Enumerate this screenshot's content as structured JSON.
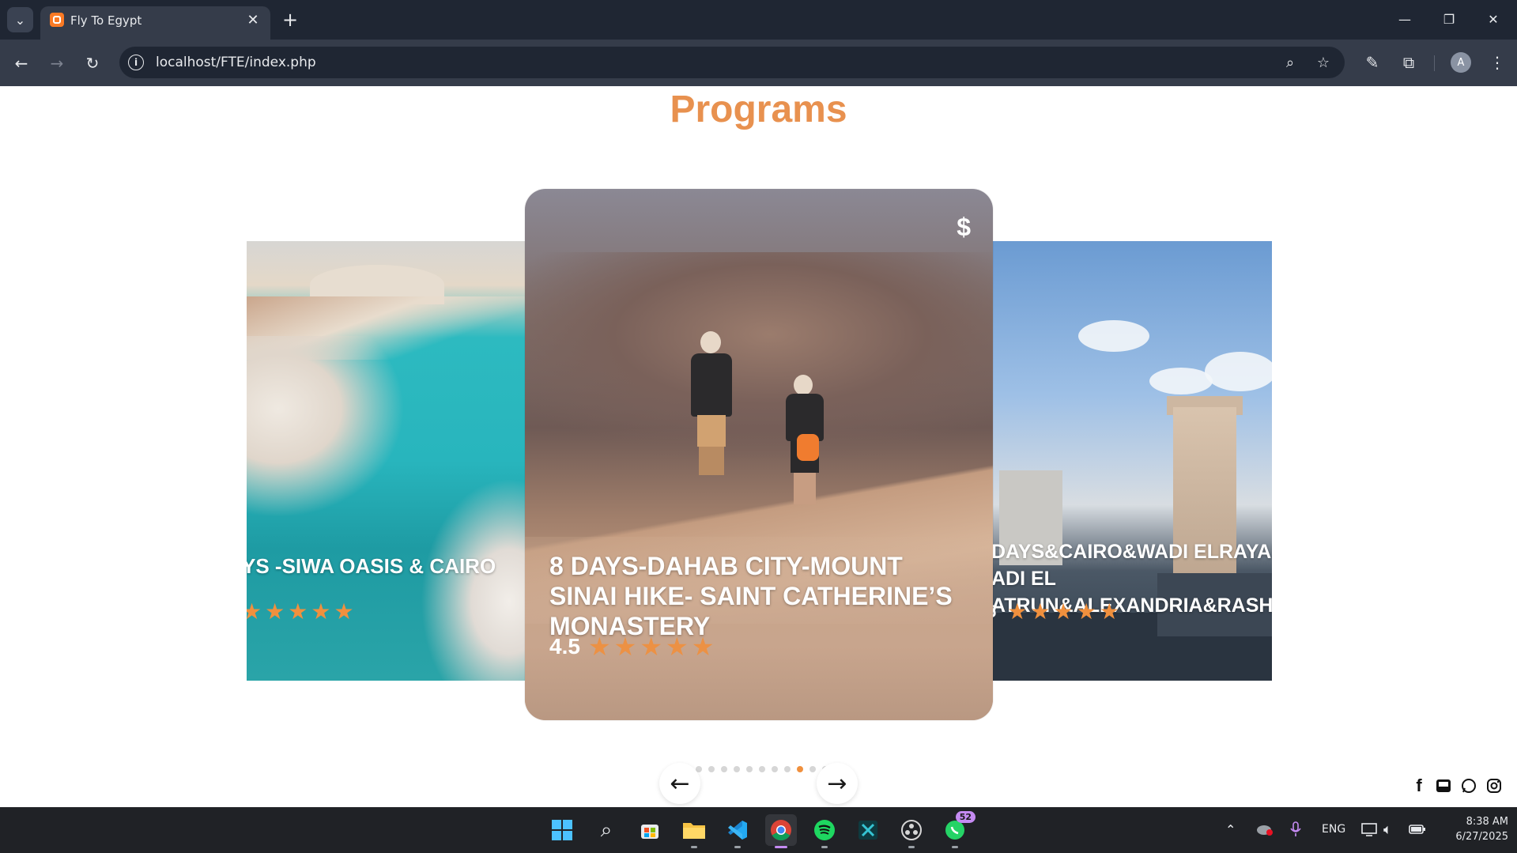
{
  "browser": {
    "tab_title": "Fly To Egypt",
    "url": "localhost/FTE/index.php",
    "avatar_initial": "A"
  },
  "page": {
    "section_title": "Programs",
    "cards": [
      {
        "position": "left",
        "title": "YS -SIWA OASIS & CAIRO",
        "rating": "",
        "stars": 5
      },
      {
        "position": "center",
        "title": "8 DAYS-DAHAB CITY-MOUNT SINAI HIKE- SAINT CATHERINE’S MONASTERY",
        "rating": "4.5",
        "stars": 5,
        "price_icon": "$"
      },
      {
        "position": "right",
        "title_lines": [
          "DAYS&CAIRO&WADI ELRAYAN",
          "ADI EL",
          "ATRUN&ALEXANDRIA&RASHI"
        ],
        "rating": "5",
        "stars": 5
      }
    ],
    "pager": {
      "total": 14,
      "active_index": 10
    },
    "social": [
      "facebook-icon",
      "inbox-icon",
      "whatsapp-icon",
      "instagram-icon"
    ]
  },
  "taskbar": {
    "apps": [
      "windows-start-icon",
      "search-icon",
      "store-icon",
      "file-explorer-icon",
      "vscode-icon",
      "chrome-icon",
      "spotify-icon",
      "app-icon",
      "obs-icon",
      "whatsapp-icon"
    ],
    "whatsapp_badge": "52",
    "language": "ENG",
    "time": "8:38 AM",
    "date": "6/27/2025"
  },
  "colors": {
    "accent": "#f0903e",
    "title": "#e8914f",
    "chrome_dark": "#1f2633",
    "chrome_mid": "#353c4a"
  }
}
